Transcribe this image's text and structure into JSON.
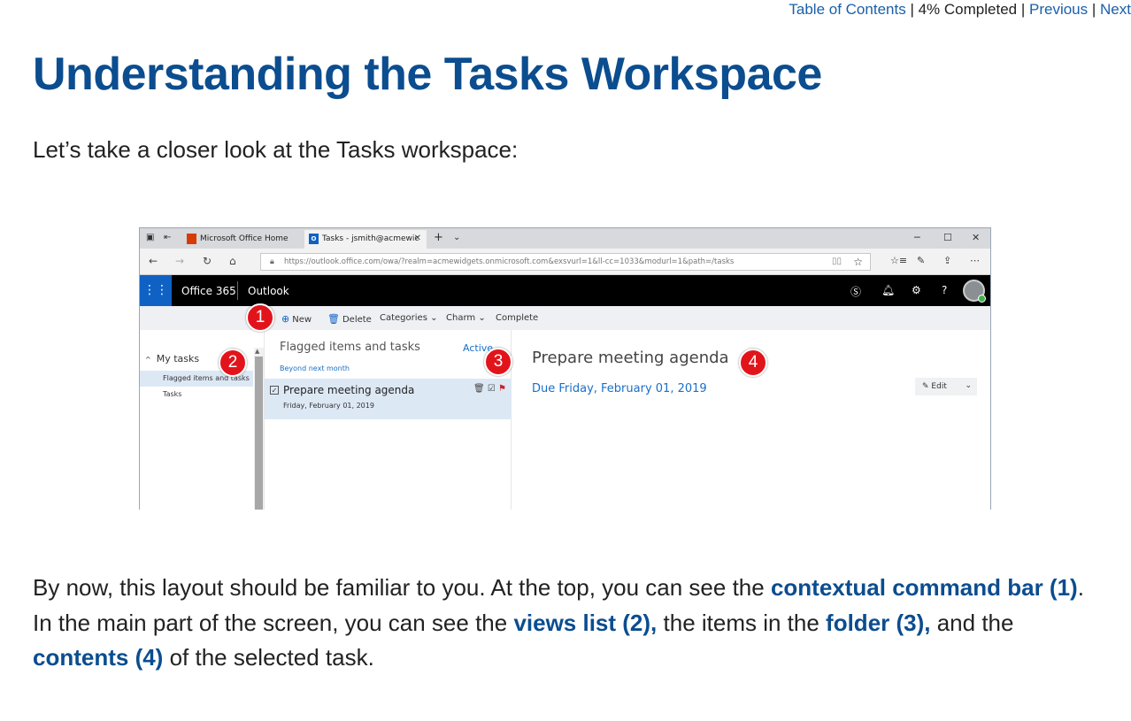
{
  "nav": {
    "toc": "Table of Contents",
    "progress": "4% Completed",
    "previous": "Previous",
    "next": "Next",
    "sep": "|"
  },
  "title": "Understanding the Tasks Workspace",
  "intro": "Let’s take a closer look at the Tasks workspace:",
  "screenshot": {
    "tabs": [
      {
        "label": "Microsoft Office Home"
      },
      {
        "label": "Tasks - jsmith@acmewiс"
      }
    ],
    "url": "https://outlook.office.com/owa/?realm=acmewidgets.onmicrosoft.com&exsvurl=1&ll-cc=1033&modurl=1&path=/tasks",
    "brand": "Office 365",
    "app": "Outlook",
    "commands": {
      "new": "New",
      "delete": "Delete",
      "categories": "Categories",
      "charm": "Charm",
      "complete": "Complete"
    },
    "views": {
      "header": "My tasks",
      "items": [
        "Flagged items and tasks",
        "Tasks"
      ]
    },
    "list": {
      "header": "Flagged items and tasks",
      "filter": "Active",
      "group": "Beyond next month",
      "task_name": "Prepare meeting agenda",
      "task_date": "Friday, February 01, 2019"
    },
    "reading": {
      "title": "Prepare meeting agenda",
      "due": "Due Friday, February 01, 2019",
      "edit": "Edit"
    },
    "callouts": [
      "1",
      "2",
      "3",
      "4"
    ]
  },
  "body": {
    "p1": "By now, this layout should be familiar to you. At the top, you can see the ",
    "b1": "contextual command bar (1)",
    "p2": ". In the main part of the screen, you can see the ",
    "b2": "views list (2),",
    "p3": " the items in the ",
    "b3": "folder (3),",
    "p4": " and the ",
    "b4": "contents (4)",
    "p5": " of the selected task."
  }
}
